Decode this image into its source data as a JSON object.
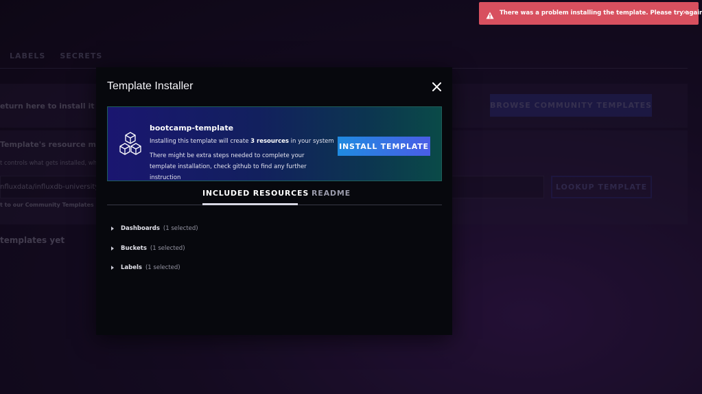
{
  "background": {
    "tabs": [
      "LABELS",
      "SECRETS"
    ],
    "return_text": "eturn here to install it",
    "browse_label": "BROWSE COMMUNITY TEMPLATES",
    "manifest_heading": "Template's resource manife",
    "manifest_desc": "t controls what gets installed, which",
    "url_value": "nfluxdata/influxdb-university/",
    "lookup_label": "LOOKUP TEMPLATE",
    "repo_text": "t to our Community Templates repo",
    "empty_text": "templates yet"
  },
  "modal": {
    "title": "Template Installer",
    "close_icon": "close-icon",
    "template": {
      "name": "bootcamp-template",
      "line1_pre": "Installing this template will create ",
      "line1_bold": "3 resources",
      "line1_post": " in your system",
      "line2": "There might be extra steps needed to complete your template installation, check github to find any further instruction",
      "icon": "cubes-icon"
    },
    "install_label": "INSTALL TEMPLATE",
    "tabs": [
      {
        "label": "INCLUDED RESOURCES",
        "active": true
      },
      {
        "label": "README",
        "active": false
      }
    ],
    "resources": [
      {
        "name": "Dashboards",
        "count": "(1 selected)"
      },
      {
        "name": "Buckets",
        "count": "(1 selected)"
      },
      {
        "name": "Labels",
        "count": "(1 selected)"
      }
    ]
  },
  "toast": {
    "message": "There was a problem installing the template. Please try again.",
    "icon": "warning-icon",
    "close": "×"
  },
  "colors": {
    "toast_bg": "#d8505f",
    "install_btn": "#4a5de6",
    "modal_bg": "#07080d"
  }
}
